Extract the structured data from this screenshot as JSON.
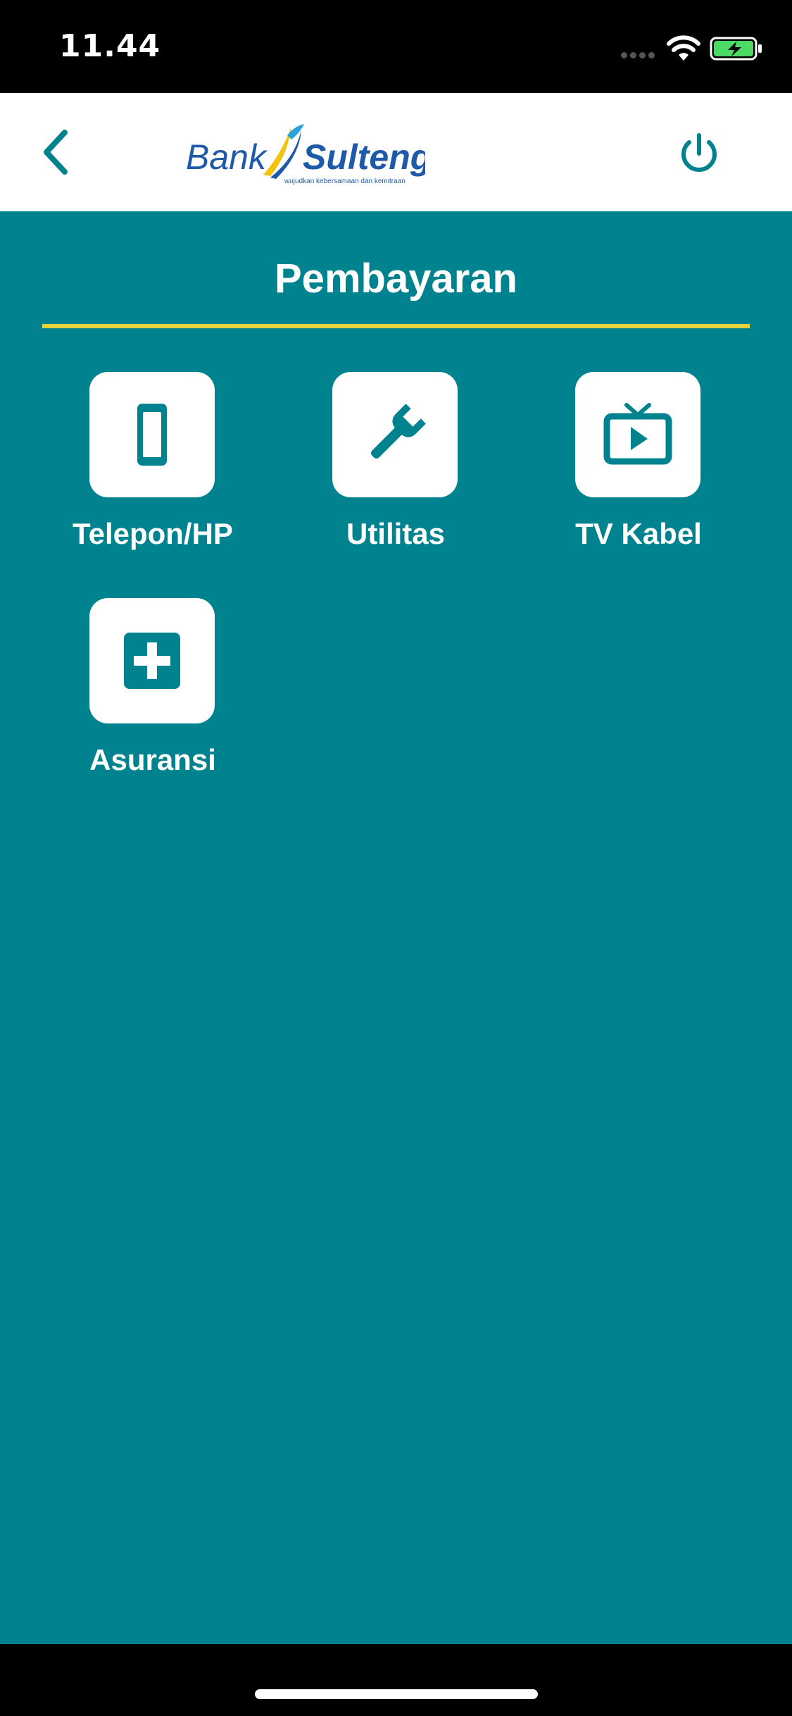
{
  "status_bar": {
    "time": "11.44",
    "icons": [
      "signal-dots-icon",
      "wifi-icon",
      "battery-charging-icon"
    ]
  },
  "header": {
    "back_icon": "chevron-left-icon",
    "logo": {
      "left_text": "Bank",
      "right_text": "Sulteng",
      "tagline": "wujudkan kebersamaan dan kemitraan"
    },
    "power_icon": "power-icon"
  },
  "page": {
    "title": "Pembayaran"
  },
  "menu": {
    "items": [
      {
        "label": "Telepon/HP",
        "icon": "phone-icon"
      },
      {
        "label": "Utilitas",
        "icon": "wrench-icon"
      },
      {
        "label": "TV Kabel",
        "icon": "tv-icon"
      },
      {
        "label": "Asuransi",
        "icon": "medical-plus-icon"
      }
    ]
  },
  "colors": {
    "primary": "#00838F",
    "underline": "#E4D33F",
    "logo_blue": "#1E5AA8",
    "logo_yellow": "#F2C20F",
    "battery_green": "#4CD964"
  }
}
